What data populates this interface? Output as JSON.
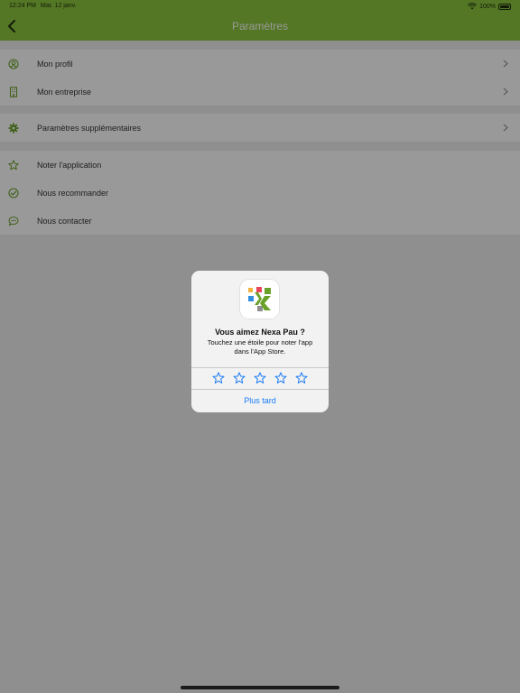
{
  "status_bar": {
    "time": "12:24 PM",
    "date": "Mar. 12 janv.",
    "battery": "100%"
  },
  "header": {
    "title": "Paramètres",
    "back_icon": "chevron-left-icon"
  },
  "colors": {
    "brand_green": "#8cc63f",
    "link_blue": "#1a7cf5",
    "icon_green": "#6aa229"
  },
  "settings": {
    "section1": [
      {
        "label": "Mon profil",
        "icon": "user-circle-icon"
      },
      {
        "label": "Mon entreprise",
        "icon": "building-icon"
      }
    ],
    "section2": [
      {
        "label": "Paramètres supplémentaires",
        "icon": "gear-icon"
      }
    ],
    "section3": [
      {
        "label": "Noter l'application",
        "icon": "star-outline-icon"
      },
      {
        "label": "Nous recommander",
        "icon": "check-circle-icon"
      },
      {
        "label": "Nous contacter",
        "icon": "chat-bubble-icon"
      }
    ]
  },
  "dialog": {
    "title": "Vous aimez Nexa Pau ?",
    "message": "Touchez une étoile pour noter l'app dans l'App Store.",
    "stars_count": 5,
    "later_label": "Plus tard"
  }
}
